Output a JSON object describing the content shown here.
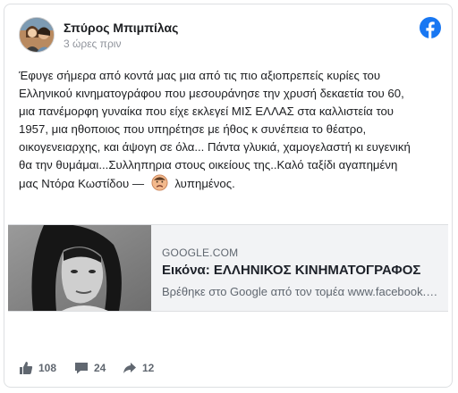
{
  "post": {
    "author": "Σπύρος Μπιμπίλας",
    "time": "3 ώρες πριν",
    "brand_icon": "facebook-icon",
    "brand_color": "#1877f2",
    "text_lines": [
      "Έφυγε σήμερα από κοντά μας μια από τις πιο αξιοπρεπείς κυρίες του",
      "Ελληνικού κινηματογράφου που μεσουράνησε την χρυσή δεκαετία του 60,",
      "μια πανέμορφη γυναίκα που είχε εκλεγεί ΜΙΣ ΕΛΛΑΣ στα καλλιστεία του",
      "1957, μια ηθοποιος που υπηρέτησε με ήθος κ συνέπεια το θέατρο,",
      "οικογενειαρχης, και άψογη σε όλα... Πάντα γλυκιά, χαμογελαστή κι ευγενική",
      "θα την θυμάμαι...Συλληπηρια στους οικείους της..Καλό ταξίδι αγαπημένη"
    ],
    "last_line": "μας Ντόρα Κωστίδου —",
    "feeling_icon": "sad-face-icon",
    "feeling": "λυπημένος."
  },
  "link_preview": {
    "domain": "GOOGLE.COM",
    "title": "Εικόνα: ΕΛΛΗΝΙΚΟΣ ΚΙΝΗΜΑΤΟΓΡΑΦΟΣ",
    "description": "Βρέθηκε στο Google από τον τομέα www.facebook.com"
  },
  "stats": {
    "likes": "108",
    "comments": "24",
    "shares": "12"
  }
}
